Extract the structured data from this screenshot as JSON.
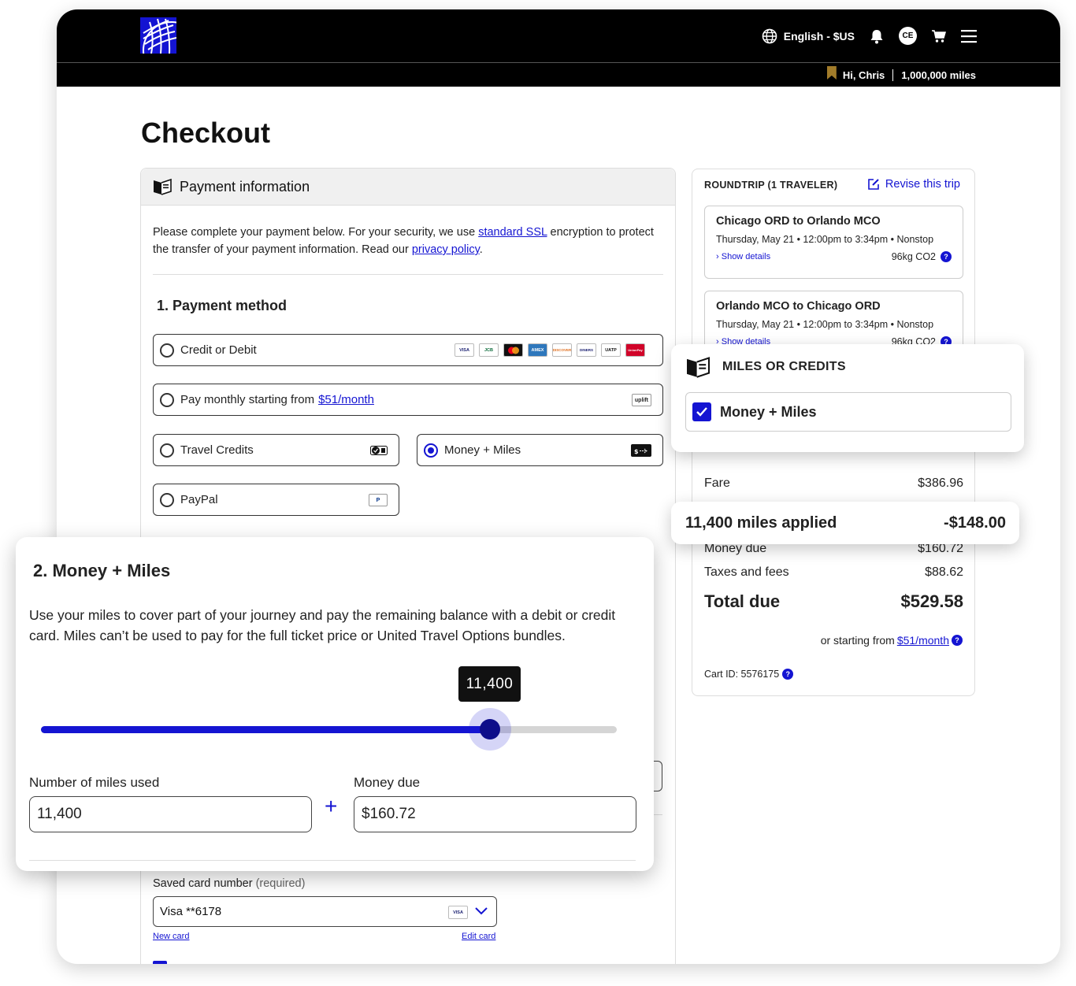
{
  "header": {
    "language": "English - $US",
    "avatar_initials": "CE",
    "greeting": "Hi, Chris",
    "miles": "1,000,000 miles",
    "icons": [
      "globe-icon",
      "bell-icon",
      "cart-icon",
      "menu-icon"
    ]
  },
  "page": {
    "title": "Checkout"
  },
  "payment": {
    "heading": "Payment information",
    "intro_before": "Please complete your payment below. For your security, we use ",
    "ssl_link": "standard SSL",
    "intro_middle": " encryption to protect the transfer of your payment information. Read our ",
    "privacy_link": "privacy policy",
    "intro_after": ".",
    "method_heading": "1. Payment method",
    "options": {
      "credit": "Credit or Debit",
      "monthly_prefix": "Pay monthly starting from",
      "monthly_link": "$51/month",
      "travel_credits": "Travel Credits",
      "money_miles": "Money + Miles",
      "paypal": "PayPal"
    },
    "card_brands": [
      "VISA",
      "JCB",
      "MC",
      "AMEX",
      "DISCOVER",
      "DINERS",
      "UATP",
      "UnionPay"
    ],
    "uplift_badge": "uplift",
    "saved_card_label": "Saved card number",
    "saved_card_required": "(required)",
    "saved_card_value": "Visa **6178",
    "saved_card_brand": "VISA",
    "new_card": "New card",
    "edit_card": "Edit card"
  },
  "trip": {
    "heading": "ROUNDTRIP (1 TRAVELER)",
    "revise": "Revise this trip",
    "segments": [
      {
        "route": "Chicago ORD to Orlando MCO",
        "details": "Thursday, May 21 • 12:00pm to 3:34pm • Nonstop",
        "show": "Show details",
        "co2": "96kg CO2"
      },
      {
        "route": "Orlando MCO to Chicago ORD",
        "details": "Thursday, May 21 • 12:00pm to 3:34pm • Nonstop",
        "show": "Show details",
        "co2": "96kg CO2"
      }
    ],
    "fare_label": "Fare",
    "fare_value": "$386.96",
    "money_due_label": "Money due",
    "money_due_value": "$160.72",
    "taxes_label": "Taxes and fees",
    "taxes_value": "$88.62",
    "total_label": "Total due",
    "total_value": "$529.58",
    "starting_prefix": "or starting from",
    "starting_link": "$51/month",
    "cart_id": "Cart ID: 5576175"
  },
  "miles_overlay": {
    "heading": "MILES OR CREDITS",
    "option": "Money + Miles"
  },
  "applied_overlay": {
    "label": "11,400 miles applied",
    "value": "-$148.00"
  },
  "money_miles_panel": {
    "title": "2. Money + Miles",
    "description": "Use your miles to cover part of your journey and pay the remaining balance with a debit or credit card. Miles can’t be used to pay for the full ticket price or United Travel Options bundles.",
    "slider_value": "11,400",
    "slider_fraction": 0.78,
    "miles_label": "Number of miles used",
    "miles_value": "11,400",
    "money_label": "Money due",
    "money_value": "$160.72"
  },
  "colors": {
    "brand_blue": "#1414d2",
    "header_bg": "#000000",
    "gold": "#a27c2a"
  }
}
